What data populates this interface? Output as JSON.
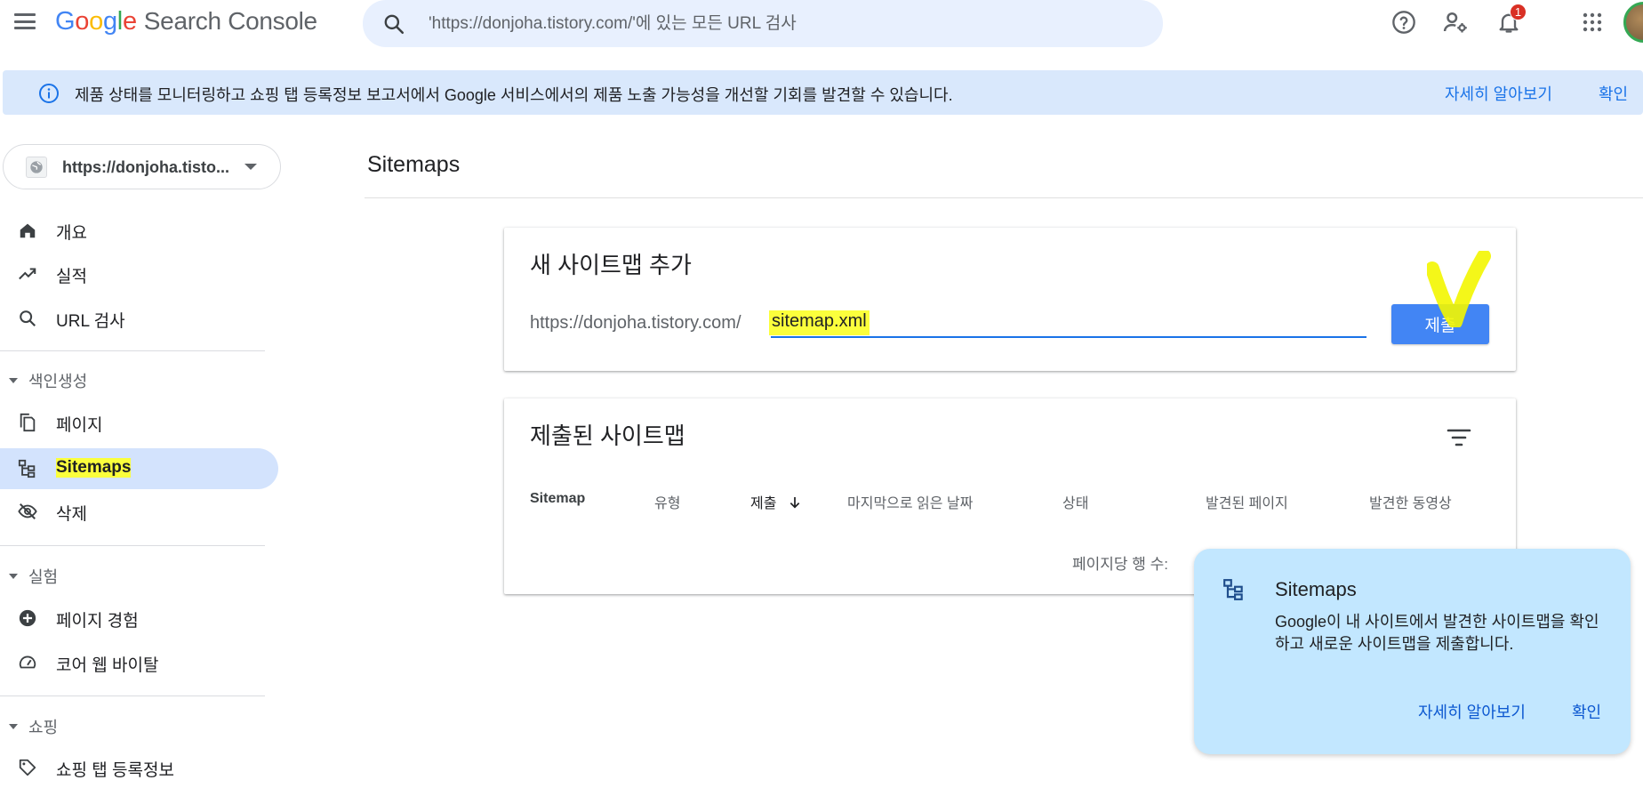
{
  "header": {
    "logo": {
      "G": "G",
      "o1": "o",
      "o2": "o",
      "g": "g",
      "l": "l",
      "e": "e",
      "product": "Search Console"
    },
    "search_placeholder": "'https://donjoha.tistory.com/'에 있는 모든 URL 검사",
    "notification_count": "1",
    "icons": [
      "menu-icon",
      "search-icon",
      "help-icon",
      "manage-users-icon",
      "notifications-icon",
      "apps-icon",
      "avatar"
    ]
  },
  "banner": {
    "text": "제품 상태를 모니터링하고 쇼핑 탭 등록정보 보고서에서 Google 서비스에서의 제품 노출 가능성을 개선할 기회를 발견할 수 있습니다.",
    "learn_more": "자세히 알아보기",
    "dismiss": "확인"
  },
  "sidebar": {
    "property": "https://donjoha.tisto...",
    "items": [
      {
        "label": "개요",
        "icon": "home-icon"
      },
      {
        "label": "실적",
        "icon": "trending-icon"
      },
      {
        "label": "URL 검사",
        "icon": "search-icon"
      }
    ],
    "sections": [
      {
        "title": "색인생성",
        "items": [
          {
            "label": "페이지",
            "icon": "pages-icon"
          },
          {
            "label": "Sitemaps",
            "icon": "sitemap-icon",
            "active": true
          },
          {
            "label": "삭제",
            "icon": "visibility-off-icon"
          }
        ]
      },
      {
        "title": "실험",
        "items": [
          {
            "label": "페이지 경험",
            "icon": "add-circle-icon"
          },
          {
            "label": "코어 웹 바이탈",
            "icon": "speed-icon"
          }
        ]
      },
      {
        "title": "쇼핑",
        "items": [
          {
            "label": "쇼핑 탭 등록정보",
            "icon": "tag-icon"
          }
        ]
      }
    ]
  },
  "main": {
    "page_title": "Sitemaps",
    "add_card": {
      "title": "새 사이트맵 추가",
      "url_prefix": "https://donjoha.tistory.com/",
      "input_value": "sitemap.xml",
      "submit_label": "제출"
    },
    "submitted_card": {
      "title": "제출된 사이트맵",
      "columns": [
        "Sitemap",
        "유형",
        "제출",
        "마지막으로 읽은 날짜",
        "상태",
        "발견된 페이지",
        "발견한 동영상"
      ],
      "rows_per_page_label": "페이지당 행 수:"
    }
  },
  "popup": {
    "title": "Sitemaps",
    "body": "Google이 내 사이트에서 발견한 사이트맵을 확인하고 새로운 사이트맵을 제출합니다.",
    "learn_more": "자세히 알아보기",
    "ok": "확인"
  },
  "colors": {
    "accent": "#1a73e8",
    "submit_button": "#4285f4",
    "banner_bg": "#d9e8fc",
    "popup_bg": "#c2e7ff",
    "highlight": "#fbff3c",
    "active_nav_bg": "#d3e3fd"
  }
}
